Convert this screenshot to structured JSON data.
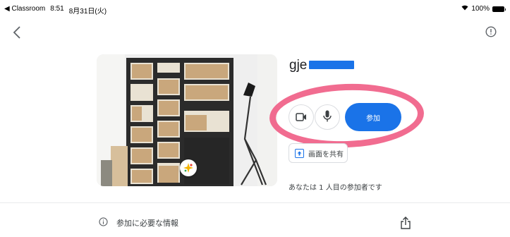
{
  "status_bar": {
    "back_app": "◀ Classroom",
    "time": "8:51",
    "date": "8月31日(火)",
    "battery": "100%"
  },
  "header": {
    "back_icon": "chevron-left-icon",
    "info_icon": "info-outline-icon"
  },
  "meeting": {
    "title": "gje",
    "join_label": "参加",
    "share_screen_label": "画面を共有",
    "participant_status": "あなたは 1 人目の参加者です"
  },
  "controls": {
    "camera_icon": "video-camera-icon",
    "mic_icon": "microphone-icon",
    "effects_icon": "sparkle-effects-icon"
  },
  "footer": {
    "info_label": "参加に必要な情報",
    "share_icon": "upload-share-icon"
  },
  "colors": {
    "accent": "#1a73e8",
    "annotation": "#f05c84"
  }
}
